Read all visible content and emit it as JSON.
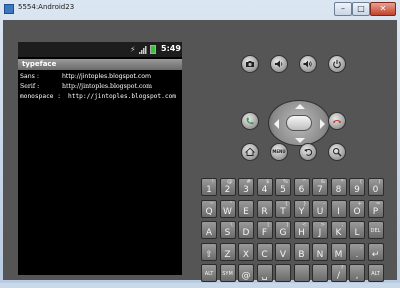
{
  "window": {
    "title": "5554:Android23",
    "minimize_label": "–",
    "maximize_label": "□",
    "close_label": "✕"
  },
  "status_bar": {
    "time": "5:49"
  },
  "app": {
    "title": "typeface",
    "rows": [
      {
        "label": "Sans :",
        "value": "http://jintoples.blogspot.com"
      },
      {
        "label": "Serif :",
        "value": "http://jintoples.blogspot.com"
      },
      {
        "label": "monospace :",
        "value": "http://jintoples.blogspot.com"
      }
    ]
  },
  "controls": {
    "menu_label": "MENU"
  },
  "keyboard": {
    "rows": [
      [
        {
          "main": "1",
          "sub": "!"
        },
        {
          "main": "2",
          "sub": "@"
        },
        {
          "main": "3",
          "sub": "#"
        },
        {
          "main": "4",
          "sub": "$"
        },
        {
          "main": "5",
          "sub": "%"
        },
        {
          "main": "6",
          "sub": "^"
        },
        {
          "main": "7",
          "sub": "&"
        },
        {
          "main": "8",
          "sub": "*"
        },
        {
          "main": "9",
          "sub": "("
        },
        {
          "main": "0",
          "sub": ")"
        }
      ],
      [
        {
          "main": "Q",
          "sub": "~"
        },
        {
          "main": "W",
          "sub": "\""
        },
        {
          "main": "E",
          "sub": ""
        },
        {
          "main": "R",
          "sub": ""
        },
        {
          "main": "T",
          "sub": "{"
        },
        {
          "main": "Y",
          "sub": "}"
        },
        {
          "main": "U",
          "sub": "-"
        },
        {
          "main": "I",
          "sub": ""
        },
        {
          "main": "O",
          "sub": "+"
        },
        {
          "main": "P",
          "sub": "="
        }
      ],
      [
        {
          "main": "A",
          "sub": ""
        },
        {
          "main": "S",
          "sub": "\\"
        },
        {
          "main": "D",
          "sub": ""
        },
        {
          "main": "F",
          "sub": "["
        },
        {
          "main": "G",
          "sub": "]"
        },
        {
          "main": "H",
          "sub": "<"
        },
        {
          "main": "J",
          "sub": ">"
        },
        {
          "main": "K",
          "sub": ";"
        },
        {
          "main": "L",
          "sub": ":"
        },
        {
          "main": "DEL",
          "sub": ""
        }
      ],
      [
        {
          "main": "⇧",
          "sub": ""
        },
        {
          "main": "Z",
          "sub": ""
        },
        {
          "main": "X",
          "sub": ""
        },
        {
          "main": "C",
          "sub": ""
        },
        {
          "main": "V",
          "sub": ""
        },
        {
          "main": "B",
          "sub": ""
        },
        {
          "main": "N",
          "sub": ""
        },
        {
          "main": "M",
          "sub": ""
        },
        {
          "main": ".",
          "sub": ","
        },
        {
          "main": "↵",
          "sub": ""
        }
      ],
      [
        {
          "main": "ALT",
          "sub": ""
        },
        {
          "main": "SYM",
          "sub": ""
        },
        {
          "main": "@",
          "sub": ""
        },
        {
          "main": "␣",
          "sub": ""
        },
        {
          "main": "",
          "sub": ""
        },
        {
          "main": "",
          "sub": ""
        },
        {
          "main": "",
          "sub": ""
        },
        {
          "main": "/",
          "sub": "?"
        },
        {
          "main": ",",
          "sub": ""
        },
        {
          "main": "ALT",
          "sub": ""
        }
      ]
    ]
  },
  "colors": {
    "emulator_body": "#555555",
    "screen_bg": "#000000",
    "app_title_bg": "#8a8a8a",
    "call_green": "#2ea043",
    "end_call_red": "#c0392b"
  }
}
